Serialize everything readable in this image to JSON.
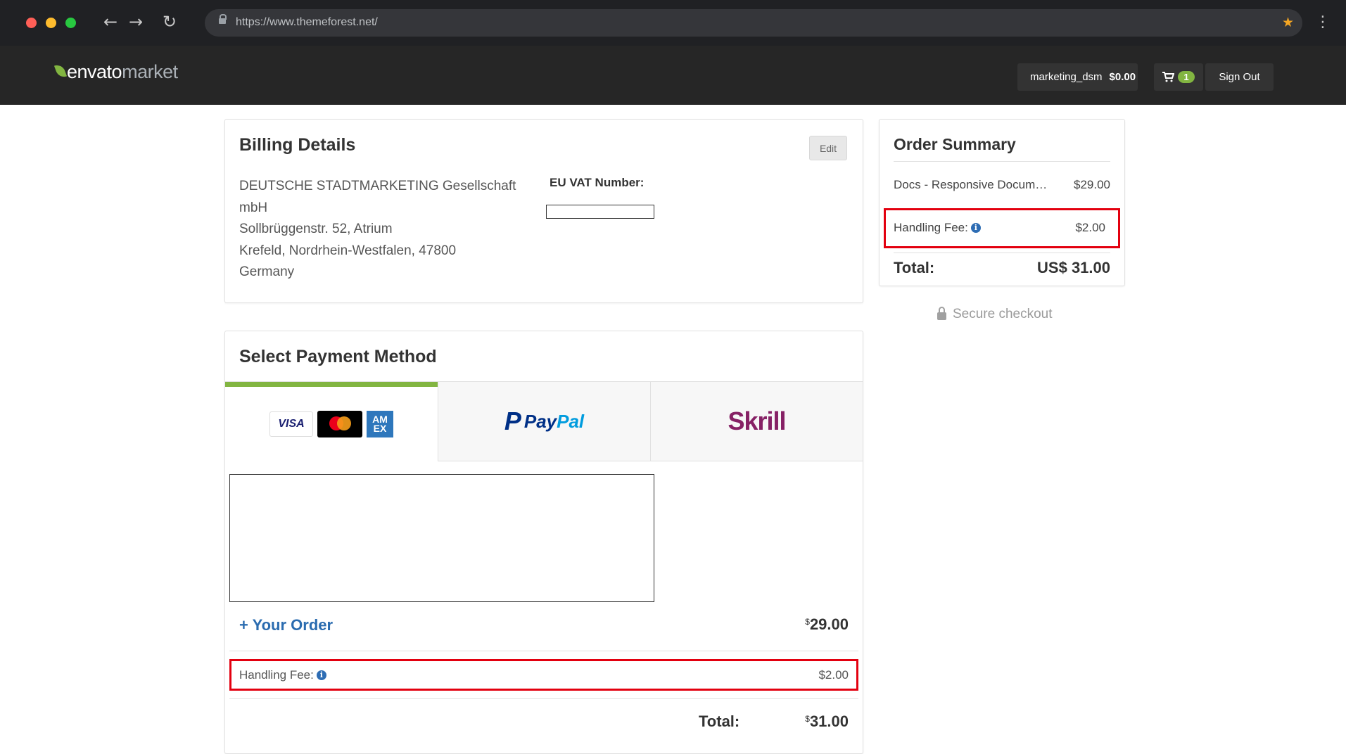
{
  "browser": {
    "url": "https://www.themeforest.net/",
    "window_controls": {
      "close_color": "#ff5f57",
      "minimize_color": "#febc2e",
      "maximize_color": "#28c840"
    }
  },
  "header": {
    "logo": {
      "part1": "envato",
      "part2": "market"
    },
    "username": "marketing_dsm",
    "balance": "$0.00",
    "cart_count": "1",
    "sign_out_label": "Sign Out"
  },
  "billing": {
    "title": "Billing Details",
    "edit_label": "Edit",
    "address_lines": [
      "DEUTSCHE STADTMARKETING Gesellschaft",
      "mbH",
      "Sollbrüggenstr. 52, Atrium",
      "Krefeld, Nordrhein-Westfalen, 47800",
      "Germany"
    ],
    "vat_label": "EU VAT Number:"
  },
  "payment": {
    "title": "Select Payment Method",
    "tabs": [
      {
        "label": "Card",
        "logos": [
          "VISA",
          "mastercard",
          "AMEX"
        ]
      },
      {
        "label": "PayPal",
        "logo_part1": "Pay",
        "logo_part2": "Pal"
      },
      {
        "label": "Skrill",
        "logo": "Skrill"
      }
    ],
    "your_order_label": "+ Your Order",
    "your_order_currency": "$",
    "your_order_amount": "29.00",
    "handling_fee_label": "Handling Fee:",
    "handling_fee_value": "$2.00",
    "total_label": "Total:",
    "total_currency": "$",
    "total_amount": "31.00"
  },
  "summary": {
    "title": "Order Summary",
    "item_name": "Docs - Responsive Documentation Manual",
    "item_price": "$29.00",
    "handling_fee_label": "Handling Fee:",
    "handling_fee_value": "$2.00",
    "total_label": "Total:",
    "total_value": "US$ 31.00",
    "secure_label": "Secure checkout"
  },
  "colors": {
    "accent_green": "#82b541",
    "highlight_red": "#e3000f",
    "link_blue": "#2b6cb0",
    "skrill_purple": "#862165"
  }
}
